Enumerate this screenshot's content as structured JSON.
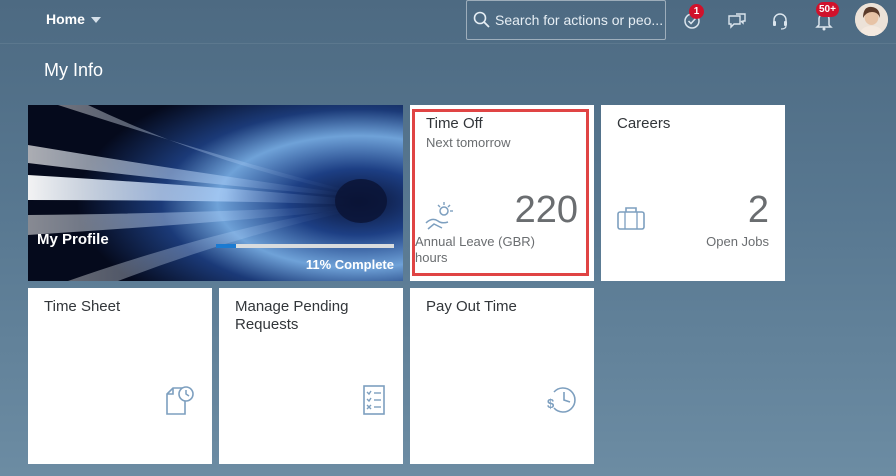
{
  "header": {
    "home_label": "Home",
    "search_placeholder": "Search for actions or peo...",
    "approvals_badge": "1",
    "notifications_badge": "50+",
    "icons": [
      "search-icon",
      "approvals-icon",
      "chat-icon",
      "headset-icon",
      "bell-icon",
      "avatar"
    ]
  },
  "page": {
    "title": "My Info"
  },
  "tiles": {
    "profile": {
      "title": "My Profile",
      "progress_label": "11% Complete",
      "progress_fraction": 0.11
    },
    "time_off": {
      "title": "Time Off",
      "subtitle": "Next tomorrow",
      "value": "220",
      "footer": "Annual Leave (GBR) hours",
      "icon": "beach-icon"
    },
    "careers": {
      "title": "Careers",
      "value": "2",
      "footer": "Open Jobs",
      "icon": "briefcase-icon"
    },
    "time_sheet": {
      "title": "Time Sheet",
      "icon": "document-clock-icon"
    },
    "manage_requests": {
      "title": "Manage Pending Requests",
      "icon": "checklist-icon"
    },
    "pay_out": {
      "title": "Pay Out Time",
      "icon": "dollar-clock-icon"
    }
  },
  "colors": {
    "accent": "#1a7ad1",
    "badge": "#d0112b",
    "highlight_border": "#e04444",
    "tile_bg": "#ffffff",
    "icon_blue": "#7d9fbf"
  }
}
